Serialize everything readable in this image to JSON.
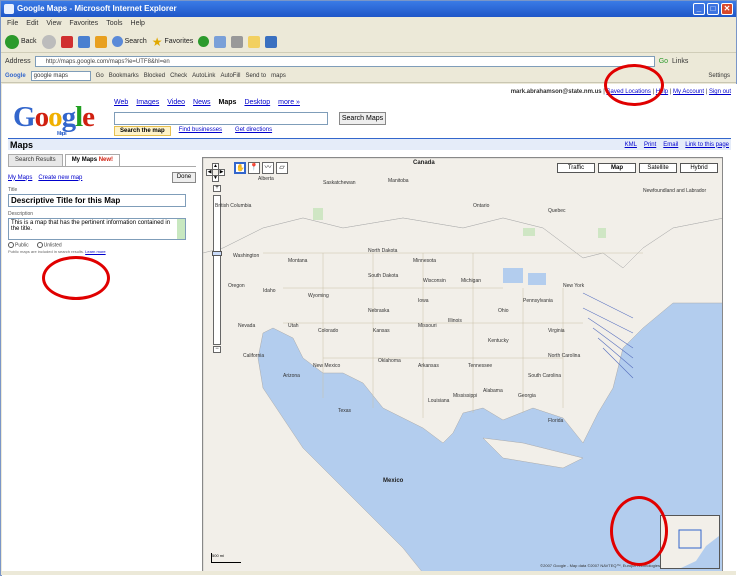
{
  "browser": {
    "title": "Google Maps - Microsoft Internet Explorer",
    "menu": [
      "File",
      "Edit",
      "View",
      "Favorites",
      "Tools",
      "Help"
    ],
    "toolbar": {
      "back": "Back",
      "search": "Search",
      "favorites": "Favorites"
    },
    "address_label": "Address",
    "url": "http://maps.google.com/maps?ie=UTF8&hl=en",
    "go": "Go",
    "links": "Links",
    "google_toolbar": {
      "brand": "Google",
      "query": "google maps",
      "go": "Go",
      "bookmarks": "Bookmarks",
      "blocked": "Blocked",
      "check": "Check",
      "autolink": "AutoLink",
      "autofill": "AutoFill",
      "send_to": "Send to",
      "query2": "maps",
      "settings": "Settings"
    }
  },
  "page": {
    "user_email": "mark.abrahamson@state.nm.us",
    "links": {
      "saved_locations": "Saved Locations",
      "help": "Help",
      "my_account": "My Account",
      "sign_out": "Sign out"
    },
    "logo": {
      "text": "Google",
      "sub": "Maps"
    },
    "nav": [
      {
        "label": "Web",
        "active": false
      },
      {
        "label": "Images",
        "active": false
      },
      {
        "label": "Video",
        "active": false
      },
      {
        "label": "News",
        "active": false
      },
      {
        "label": "Maps",
        "active": true
      },
      {
        "label": "Desktop",
        "active": false
      },
      {
        "label": "more »",
        "active": false
      }
    ],
    "search_button": "Search Maps",
    "subtabs": [
      "Search the map",
      "Find businesses",
      "Get directions"
    ],
    "maps_title": "Maps",
    "map_links": {
      "kml": "KML",
      "print": "Print",
      "email": "Email",
      "link": "Link to this page"
    }
  },
  "sidebar": {
    "tabs": {
      "search_results": "Search Results",
      "my_maps": "My Maps",
      "new_badge": "New!"
    },
    "my_maps_link": "My Maps",
    "create_link": "Create new map",
    "done_button": "Done",
    "title_label": "Title",
    "title_value": "Descriptive Title for this Map",
    "desc_label": "Description",
    "desc_value": "This is a map that has the pertinent information contained in the title.",
    "public_label": "Public",
    "unlisted_label": "Unlisted",
    "note": "Public maps are included in search results.",
    "learn_more": "Learn more"
  },
  "map": {
    "tools": [
      "hand",
      "marker",
      "line",
      "shape"
    ],
    "types": [
      {
        "label": "Traffic",
        "selected": false
      },
      {
        "label": "Map",
        "selected": true
      },
      {
        "label": "Satellite",
        "selected": false
      },
      {
        "label": "Hybrid",
        "selected": false
      }
    ],
    "labels": [
      {
        "text": "Canada",
        "big": true
      },
      {
        "text": "Alberta",
        "big": false
      },
      {
        "text": "Saskatchewan",
        "big": false
      },
      {
        "text": "Manitoba",
        "big": false
      },
      {
        "text": "Ontario",
        "big": false
      },
      {
        "text": "Quebec",
        "big": false
      },
      {
        "text": "Newfoundland and Labrador",
        "big": false
      },
      {
        "text": "British Columbia",
        "big": false
      },
      {
        "text": "Washington",
        "big": false
      },
      {
        "text": "Montana",
        "big": false
      },
      {
        "text": "North Dakota",
        "big": false
      },
      {
        "text": "Minnesota",
        "big": false
      },
      {
        "text": "South Dakota",
        "big": false
      },
      {
        "text": "Wisconsin",
        "big": false
      },
      {
        "text": "Michigan",
        "big": false
      },
      {
        "text": "Oregon",
        "big": false
      },
      {
        "text": "Idaho",
        "big": false
      },
      {
        "text": "Wyoming",
        "big": false
      },
      {
        "text": "Nebraska",
        "big": false
      },
      {
        "text": "Iowa",
        "big": false
      },
      {
        "text": "Illinois",
        "big": false
      },
      {
        "text": "Ohio",
        "big": false
      },
      {
        "text": "Pennsylvania",
        "big": false
      },
      {
        "text": "New York",
        "big": false
      },
      {
        "text": "Nevada",
        "big": false
      },
      {
        "text": "Utah",
        "big": false
      },
      {
        "text": "Colorado",
        "big": false
      },
      {
        "text": "Kansas",
        "big": false
      },
      {
        "text": "Missouri",
        "big": false
      },
      {
        "text": "Kentucky",
        "big": false
      },
      {
        "text": "Virginia",
        "big": false
      },
      {
        "text": "California",
        "big": false
      },
      {
        "text": "Arizona",
        "big": false
      },
      {
        "text": "New Mexico",
        "big": false
      },
      {
        "text": "Oklahoma",
        "big": false
      },
      {
        "text": "Arkansas",
        "big": false
      },
      {
        "text": "Tennessee",
        "big": false
      },
      {
        "text": "North Carolina",
        "big": false
      },
      {
        "text": "South Carolina",
        "big": false
      },
      {
        "text": "Texas",
        "big": false
      },
      {
        "text": "Louisiana",
        "big": false
      },
      {
        "text": "Mississippi",
        "big": false
      },
      {
        "text": "Alabama",
        "big": false
      },
      {
        "text": "Georgia",
        "big": false
      },
      {
        "text": "Florida",
        "big": false
      },
      {
        "text": "Mexico",
        "big": true
      }
    ],
    "scale": "500 mi",
    "copyright": "©2007 Google - Map data ©2007 NAVTEQ™, Europa Technologies"
  }
}
